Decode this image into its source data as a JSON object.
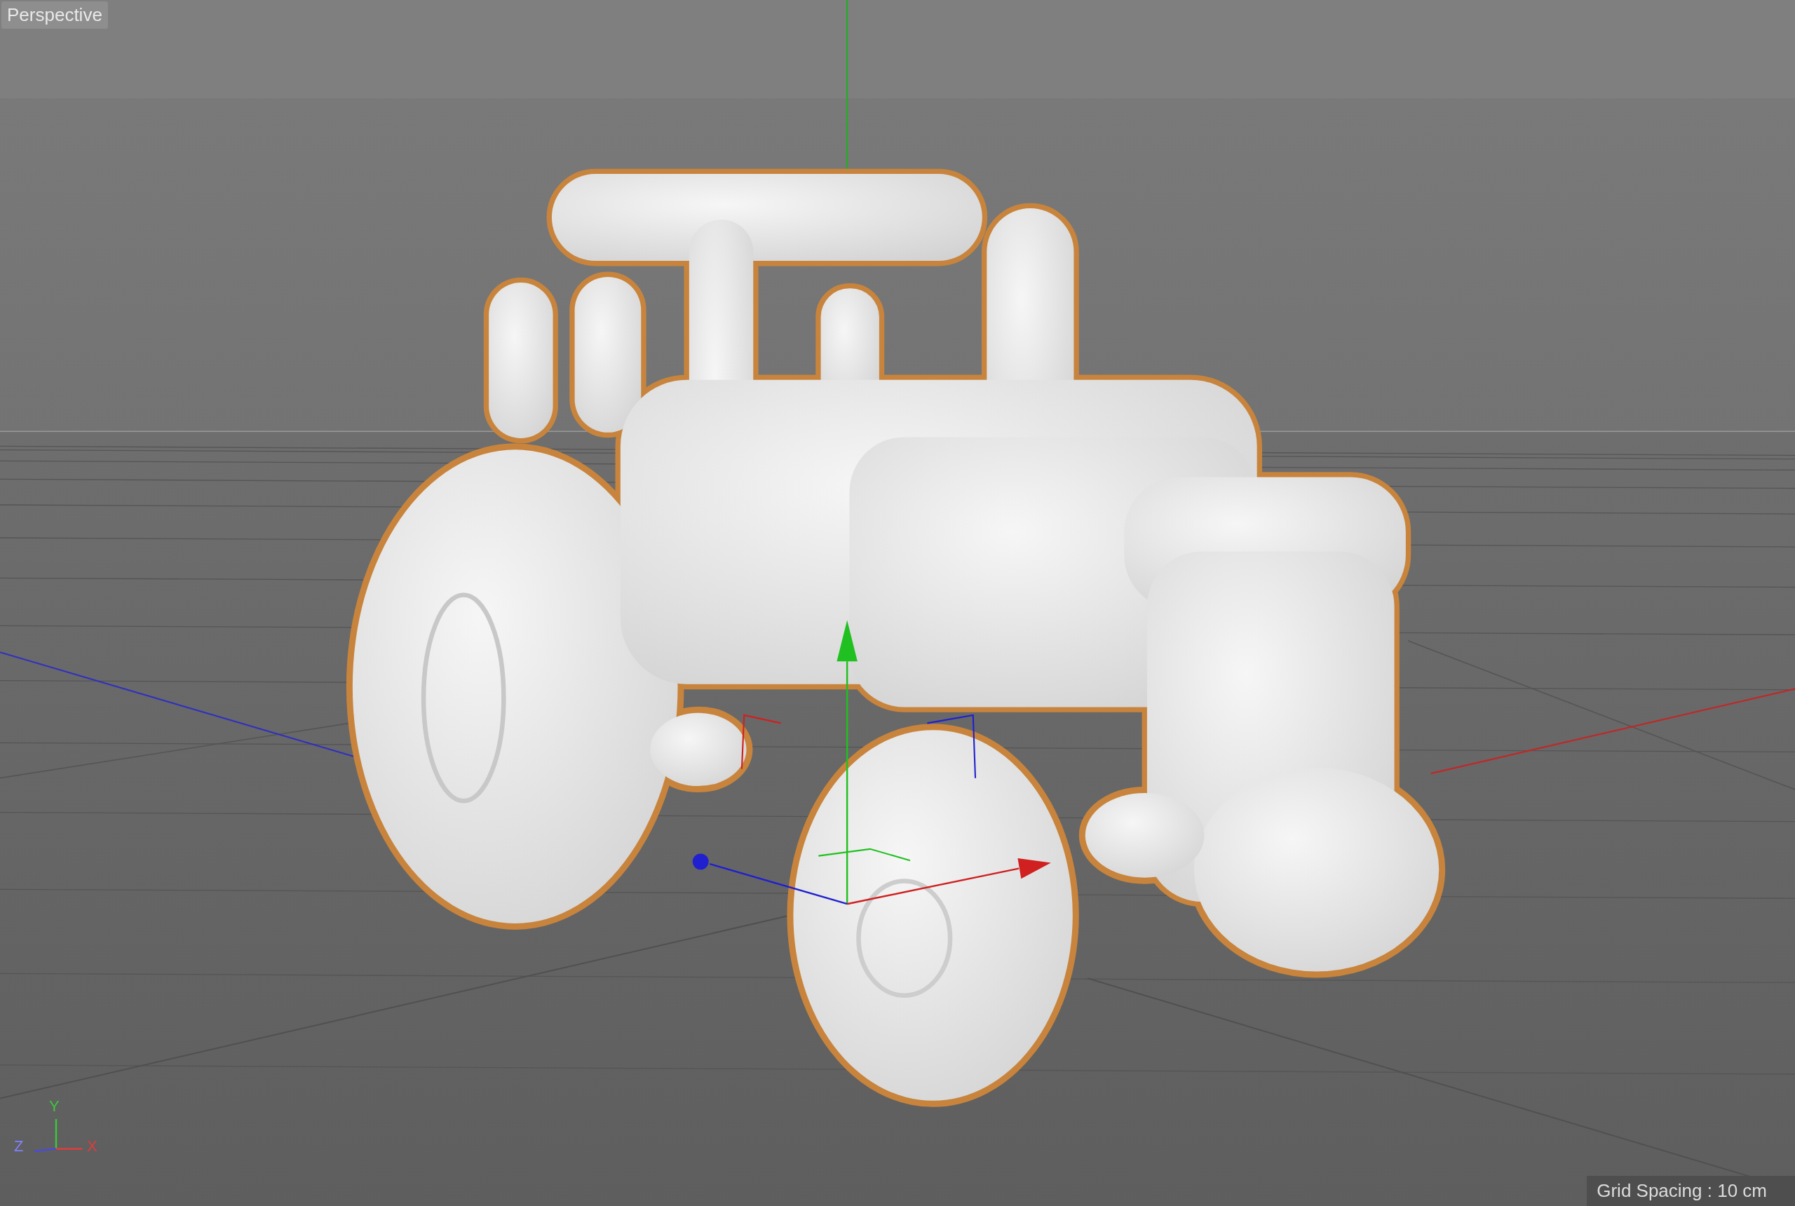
{
  "viewport": {
    "view_name": "Perspective",
    "grid_spacing": "Grid Spacing : 10 cm",
    "axis_labels": [
      {
        "text": "Y",
        "color": "#3cc83c"
      },
      {
        "text": "Z",
        "color": "#8080ff"
      },
      {
        "text": "X",
        "color": "#e03c3c"
      }
    ]
  }
}
